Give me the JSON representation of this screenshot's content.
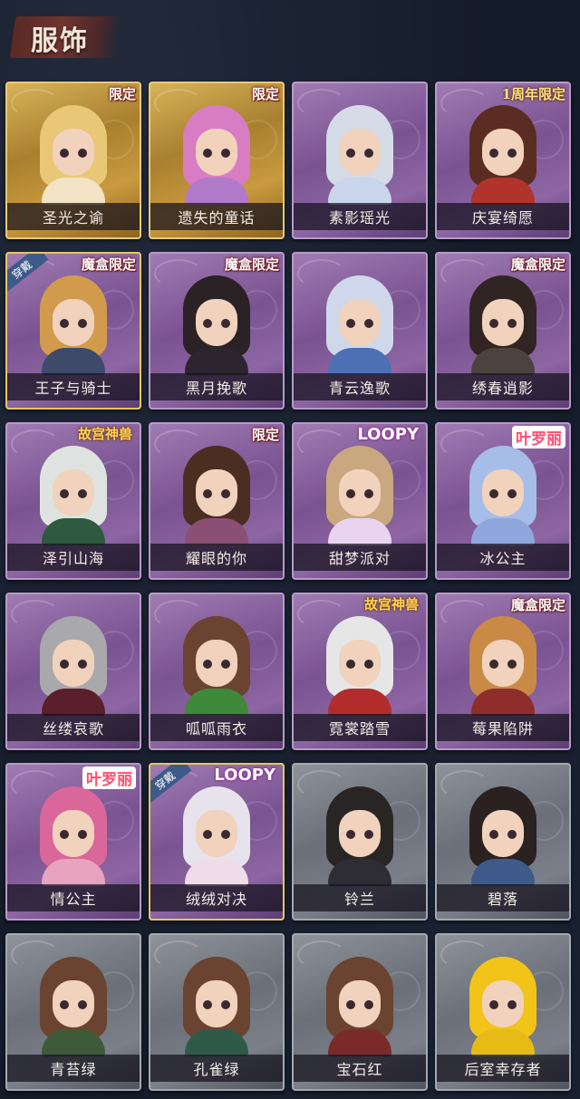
{
  "header": {
    "title": "服饰"
  },
  "items": [
    {
      "name": "圣光之谕",
      "tag": "限定",
      "style": "gold",
      "hair": "#e8c777",
      "body": "#f1e3c4",
      "worn": false
    },
    {
      "name": "遗失的童话",
      "tag": "限定",
      "style": "gold",
      "hair": "#d87dc4",
      "body": "#b07ac8",
      "worn": false
    },
    {
      "name": "素影瑶光",
      "tag": "",
      "style": "purple",
      "hair": "#d6dbe8",
      "body": "#c8d5ea",
      "worn": false
    },
    {
      "name": "庆宴绮愿",
      "tag": "1周年限定",
      "style": "purple",
      "hair": "#5b2c22",
      "body": "#b0342b",
      "worn": false
    },
    {
      "name": "王子与骑士",
      "tag": "魔盒限定",
      "style": "purple",
      "hair": "#d29a4d",
      "body": "#3d4a6a",
      "worn": true,
      "badge": "穿戴"
    },
    {
      "name": "黑月挽歌",
      "tag": "魔盒限定",
      "style": "purple",
      "hair": "#2a2224",
      "body": "#2c2530",
      "worn": false
    },
    {
      "name": "青云逸歌",
      "tag": "",
      "style": "purple",
      "hair": "#cfd8ea",
      "body": "#4d6fb4",
      "worn": false
    },
    {
      "name": "绣春逍影",
      "tag": "魔盒限定",
      "style": "purple",
      "hair": "#302522",
      "body": "#4c4240",
      "worn": false
    },
    {
      "name": "泽引山海",
      "tag": "故宫神兽",
      "style": "purple",
      "hair": "#dfe3e0",
      "body": "#2e5a40",
      "worn": false
    },
    {
      "name": "耀眼的你",
      "tag": "限定",
      "style": "purple",
      "hair": "#4a2e22",
      "body": "#8a4f72",
      "worn": false
    },
    {
      "name": "甜梦派对",
      "tag": "LOOPY",
      "style": "purple",
      "hair": "#c9a880",
      "body": "#e8d4ef",
      "worn": false
    },
    {
      "name": "冰公主",
      "tag": "叶罗丽",
      "style": "purple",
      "hair": "#a6bde8",
      "body": "#8fa7dd",
      "worn": false
    },
    {
      "name": "丝缕哀歌",
      "tag": "",
      "style": "purple",
      "hair": "#a9a8ad",
      "body": "#5b1f2c",
      "worn": false
    },
    {
      "name": "呱呱雨衣",
      "tag": "",
      "style": "purple",
      "hair": "#6a4430",
      "body": "#3e8a3a",
      "worn": false
    },
    {
      "name": "霓裳踏雪",
      "tag": "故宫神兽",
      "style": "purple",
      "hair": "#e6e6e6",
      "body": "#b22c2c",
      "worn": false
    },
    {
      "name": "莓果陷阱",
      "tag": "魔盒限定",
      "style": "purple",
      "hair": "#c98a45",
      "body": "#8f2d2a",
      "worn": false
    },
    {
      "name": "情公主",
      "tag": "叶罗丽",
      "style": "purple",
      "hair": "#d9679a",
      "body": "#e7a4bf",
      "worn": false
    },
    {
      "name": "绒绒对决",
      "tag": "LOOPY",
      "style": "purple",
      "hair": "#e7e3ec",
      "body": "#f0dce8",
      "worn": true,
      "badge": "穿戴"
    },
    {
      "name": "铃兰",
      "tag": "",
      "style": "gray",
      "hair": "#2a2525",
      "body": "#2d2d33",
      "worn": false
    },
    {
      "name": "碧落",
      "tag": "",
      "style": "gray",
      "hair": "#2a2220",
      "body": "#3e5a8a",
      "worn": false
    },
    {
      "name": "青苔绿",
      "tag": "",
      "style": "gray",
      "hair": "#6a4430",
      "body": "#3f5a3a",
      "worn": false
    },
    {
      "name": "孔雀绿",
      "tag": "",
      "style": "gray",
      "hair": "#6a4430",
      "body": "#2f5a4a",
      "worn": false
    },
    {
      "name": "宝石红",
      "tag": "",
      "style": "gray",
      "hair": "#6a4430",
      "body": "#7a2a2a",
      "worn": false
    },
    {
      "name": "后室幸存者",
      "tag": "",
      "style": "gray",
      "hair": "#f2c318",
      "body": "#e7bb16",
      "worn": false
    }
  ]
}
